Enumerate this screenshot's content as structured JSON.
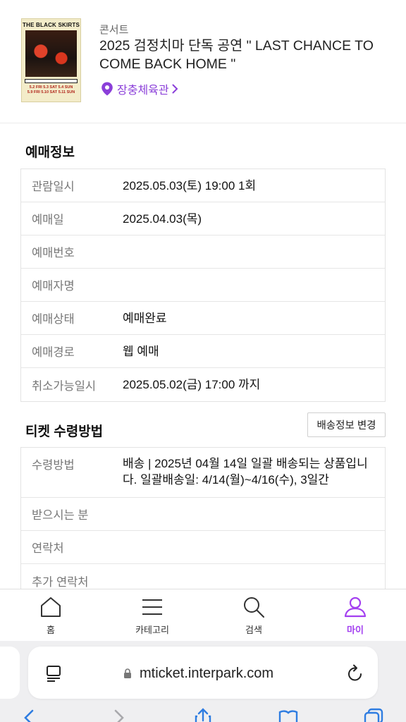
{
  "event": {
    "category": "콘서트",
    "title": "2025 검정치마 단독 공연  \" LAST CHANCE TO COME BACK HOME \"",
    "venue": "장충체육관",
    "poster": {
      "band": "THE BLACK SKIRTS",
      "subtitle": "\"LAST CHANCE TO COME BACK HOME\"",
      "dates_row1": [
        "5.2 FRI",
        "5.3 SAT",
        "5.4 SUN"
      ],
      "dates_row2": [
        "5.9 FRI",
        "5.10 SAT",
        "5.11 SUN"
      ]
    }
  },
  "booking": {
    "heading": "예매정보",
    "rows": [
      {
        "label": "관람일시",
        "value": "2025.05.03(토) 19:00 1회"
      },
      {
        "label": "예매일",
        "value": "2025.04.03(목)"
      },
      {
        "label": "예매번호",
        "value": ""
      },
      {
        "label": "예매자명",
        "value": ""
      },
      {
        "label": "예매상태",
        "value": "예매완료"
      },
      {
        "label": "예매경로",
        "value": "웹 예매"
      },
      {
        "label": "취소가능일시",
        "value": "2025.05.02(금) 17:00 까지"
      }
    ]
  },
  "ticket": {
    "heading": "티켓 수령방법",
    "change_button": "배송정보 변경",
    "rows": [
      {
        "label": "수령방법",
        "value": "배송 | 2025년 04월 14일 일괄 배송되는 상품입니다. 일괄배송일: 4/14(월)~4/16(수), 3일간"
      },
      {
        "label": "받으시는 분",
        "value": ""
      },
      {
        "label": "연락처",
        "value": ""
      },
      {
        "label": "추가 연락처",
        "value": ""
      }
    ]
  },
  "tabbar": {
    "items": [
      {
        "label": "홈",
        "icon": "home-icon"
      },
      {
        "label": "카테고리",
        "icon": "menu-icon"
      },
      {
        "label": "검색",
        "icon": "search-icon"
      },
      {
        "label": "마이",
        "icon": "person-icon"
      }
    ],
    "active_color": "#a33ff0"
  },
  "browser": {
    "url": "mticket.interpark.com"
  },
  "colors": {
    "accent": "#8b3fd9"
  }
}
